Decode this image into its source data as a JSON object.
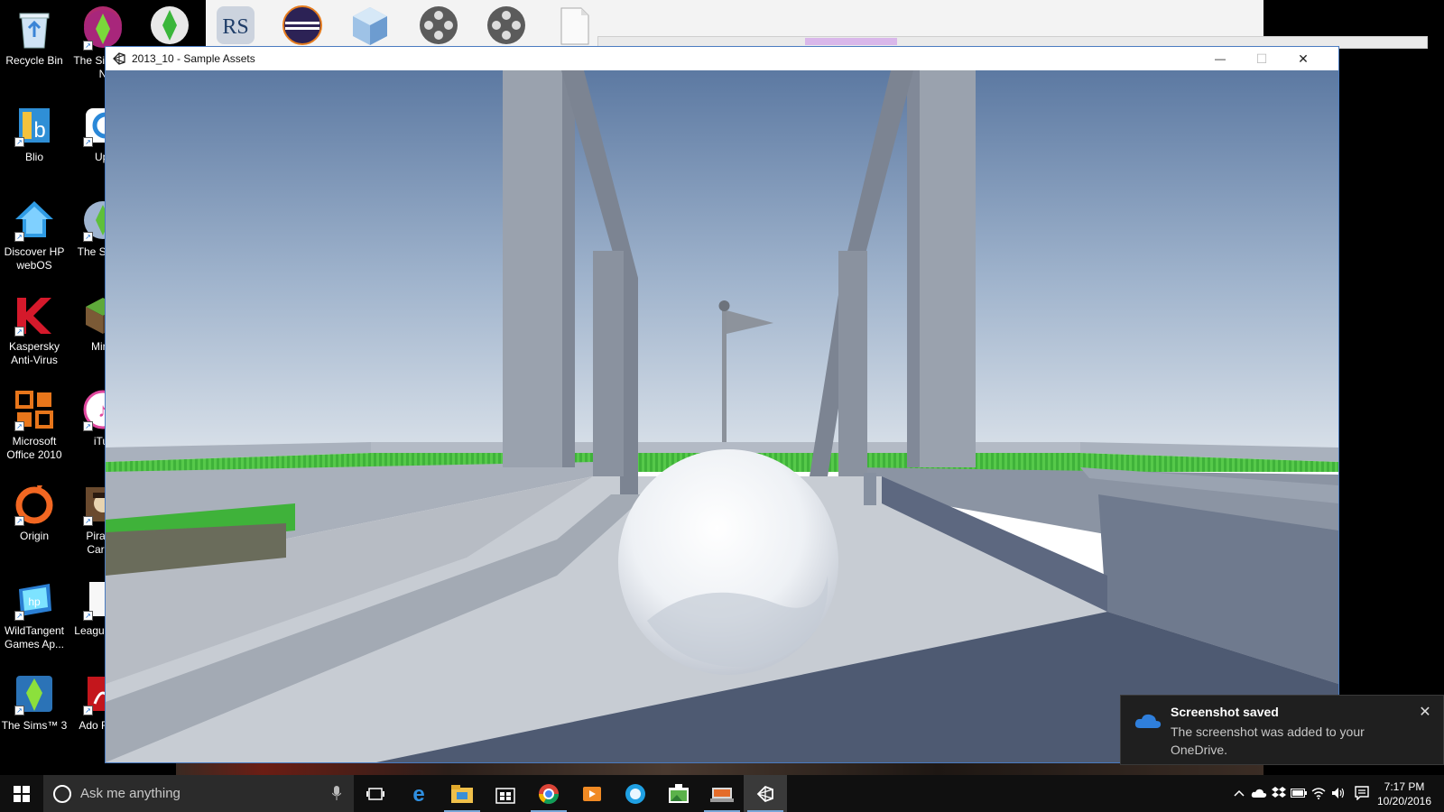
{
  "desktop": {
    "icons_col1": [
      {
        "label": "Recycle Bin",
        "icon": "recycle-bin-icon",
        "shortcut": false
      },
      {
        "label": "Blio",
        "icon": "blio-icon",
        "shortcut": true
      },
      {
        "label": "Discover HP webOS",
        "icon": "hp-webos-icon",
        "shortcut": true
      },
      {
        "label": "Kaspersky Anti-Virus",
        "icon": "kaspersky-icon",
        "shortcut": true
      },
      {
        "label": "Microsoft Office 2010",
        "icon": "office-icon",
        "shortcut": true
      },
      {
        "label": "Origin",
        "icon": "origin-icon",
        "shortcut": true
      },
      {
        "label": "WildTangent Games Ap...",
        "icon": "wildtangent-icon",
        "shortcut": true
      },
      {
        "label": "The Sims™ 3",
        "icon": "sims3-icon",
        "shortcut": true
      }
    ],
    "icons_col2": [
      {
        "label": "The Sir Late N",
        "icon": "sims-late-night-icon"
      },
      {
        "label": "Upl",
        "icon": "uplay-icon"
      },
      {
        "label": "The Sir Pe",
        "icon": "sims-pets-icon"
      },
      {
        "label": "Mine",
        "icon": "minecraft-icon"
      },
      {
        "label": "iTur",
        "icon": "itunes-icon"
      },
      {
        "label": "Pirates Caribb",
        "icon": "pirates-icon"
      },
      {
        "label": "Leagu Lege",
        "icon": "league-icon"
      },
      {
        "label": "Ado Read",
        "icon": "adobe-reader-icon"
      }
    ],
    "top_icons": [
      "sims-diamond-icon",
      "rs-icon",
      "eclipse-icon",
      "virtualbox-icon",
      "film-reel-icon",
      "film-reel-icon",
      "blank-file-icon"
    ]
  },
  "window": {
    "title": "2013_10 - Sample Assets",
    "minimize": "—",
    "maximize": "☐",
    "close": "✕"
  },
  "toast": {
    "title": "Screenshot saved",
    "body": "The screenshot was added to your OneDrive.",
    "close": "✕"
  },
  "taskbar": {
    "search_placeholder": "Ask me anything",
    "pinned": [
      "task-view-icon",
      "edge-icon",
      "file-explorer-icon",
      "store-icon",
      "chrome-icon",
      "media-player-icon",
      "skype-icon",
      "photos-icon",
      "game-icon",
      "unity-icon"
    ],
    "tray": [
      "chevron-up-icon",
      "onedrive-icon",
      "dropbox-icon",
      "battery-icon",
      "wifi-icon",
      "volume-icon",
      "notification-icon"
    ],
    "time": "7:17 PM",
    "date": "10/20/2016"
  },
  "colors": {
    "accent": "#4a7bc0",
    "sky_top": "#5e7aa3",
    "sky_horizon": "#c7d2df",
    "grass": "#3fb23a"
  }
}
